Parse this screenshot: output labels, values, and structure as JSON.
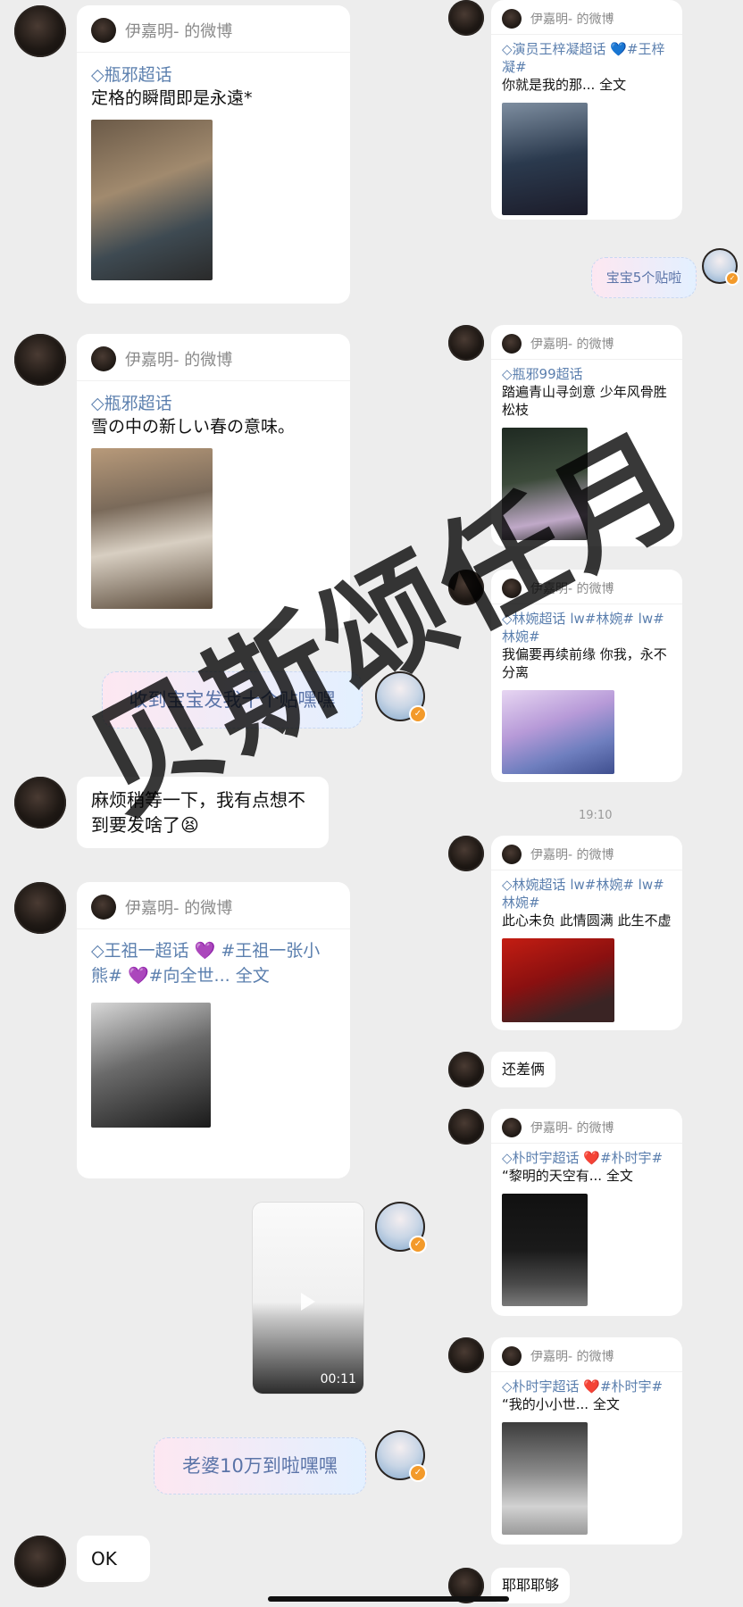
{
  "source_label": "伊嘉明- 的微博",
  "left": {
    "card1": {
      "tag": "瓶邪超话",
      "text": "定格的瞬間即是永遠*"
    },
    "card2": {
      "tag": "瓶邪超话",
      "text": "雪の中の新しい春の意味。"
    },
    "sticker1": "收到宝宝发我十个贴嘿嘿",
    "bubble1": "麻烦稍等一下，我有点想不到要发啥了😫",
    "card3": {
      "tag": "王祖一超话 💜 #王祖一张小熊# 💜#向全世... 全文",
      "text": ""
    },
    "video_duration": "00:11",
    "sticker2": "老婆10万到啦嘿嘿",
    "bubble2": "OK"
  },
  "right": {
    "card1": {
      "tag": "演员王梓凝超话 💙#王梓凝#",
      "text": "你就是我的那... 全文"
    },
    "sticker1": "宝宝5个贴啦",
    "card2": {
      "tag": "瓶邪99超话",
      "text": "踏遍青山寻剑意 少年风骨胜松枝"
    },
    "card3": {
      "tag": "林婉超话 lw#林婉# lw#林婉#",
      "text": "我偏要再续前缘 你我，永不分离"
    },
    "time": "19:10",
    "card4": {
      "tag": "林婉超话 lw#林婉# lw#林婉#",
      "text": "此心未负 此情圆满 此生不虚"
    },
    "bubble1": "还差俩",
    "card5": {
      "tag": "朴时宇超话 ❤️#朴时宇#",
      "text": "“黎明的天空有... 全文"
    },
    "card6": {
      "tag": "朴时宇超话 ❤️#朴时宇#",
      "text": "“我的小小世... 全文"
    },
    "bubble2": "耶耶耶够"
  },
  "watermark": "贝斯颂任月",
  "icons": {
    "diamond": "diamond-icon",
    "verified": "verified-badge-icon"
  }
}
